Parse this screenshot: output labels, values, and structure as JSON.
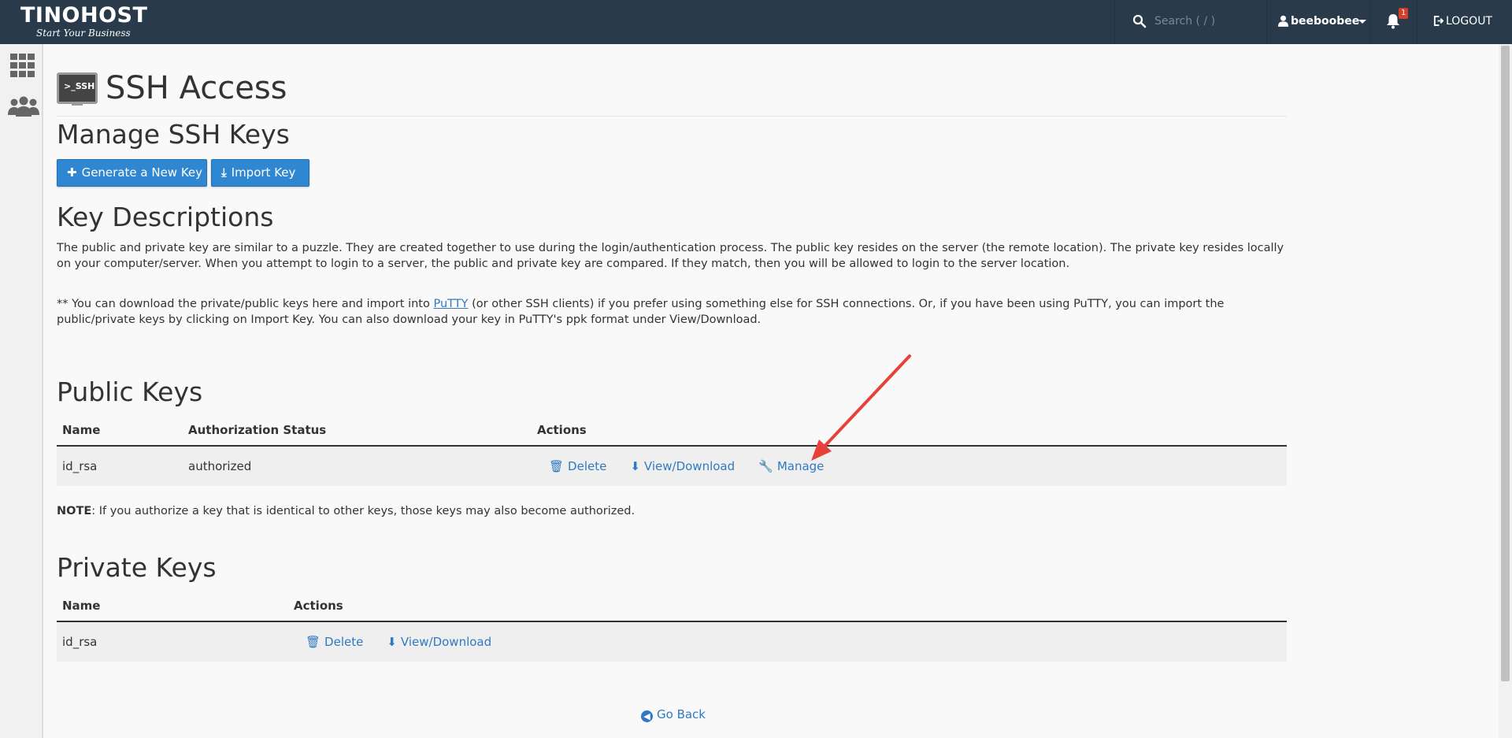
{
  "topbar": {
    "brand": "TINOHOST",
    "tagline": "Start Your Business",
    "search_placeholder": "Search ( / )",
    "username": "beeboobee",
    "notification_count": "1",
    "logout_label": "LOGOUT"
  },
  "page": {
    "title": "SSH Access",
    "icon_text": ">_SSH"
  },
  "manage": {
    "heading": "Manage SSH Keys",
    "generate_label": "Generate a New Key",
    "import_label": "Import Key"
  },
  "descriptions": {
    "heading": "Key Descriptions",
    "para1": "The public and private key are similar to a puzzle. They are created together to use during the login/authentication process. The public key resides on the server (the remote location). The private key resides locally on your computer/server. When you attempt to login to a server, the public and private key are compared. If they match, then you will be allowed to login to the server location.",
    "para2_prefix": "** You can download the private/public keys here and import into ",
    "para2_link": "PuTTY",
    "para2_suffix": " (or other SSH clients) if you prefer using something else for SSH connections. Or, if you have been using PuTTY, you can import the public/private keys by clicking on Import Key. You can also download your key in PuTTY's ppk format under View/Download."
  },
  "public_keys": {
    "heading": "Public Keys",
    "columns": [
      "Name",
      "Authorization Status",
      "Actions"
    ],
    "rows": [
      {
        "name": "id_rsa",
        "status": "authorized",
        "delete": "Delete",
        "view": "View/Download",
        "manage": "Manage"
      }
    ],
    "note_label": "NOTE",
    "note_text": ": If you authorize a key that is identical to other keys, those keys may also become authorized."
  },
  "private_keys": {
    "heading": "Private Keys",
    "columns": [
      "Name",
      "Actions"
    ],
    "rows": [
      {
        "name": "id_rsa",
        "delete": "Delete",
        "view": "View/Download"
      }
    ]
  },
  "go_back_label": "Go Back",
  "colors": {
    "topbar": "#293a4a",
    "primary_button": "#2f86d1",
    "link": "#2f7ac2",
    "annotation_arrow": "#e8413a"
  }
}
